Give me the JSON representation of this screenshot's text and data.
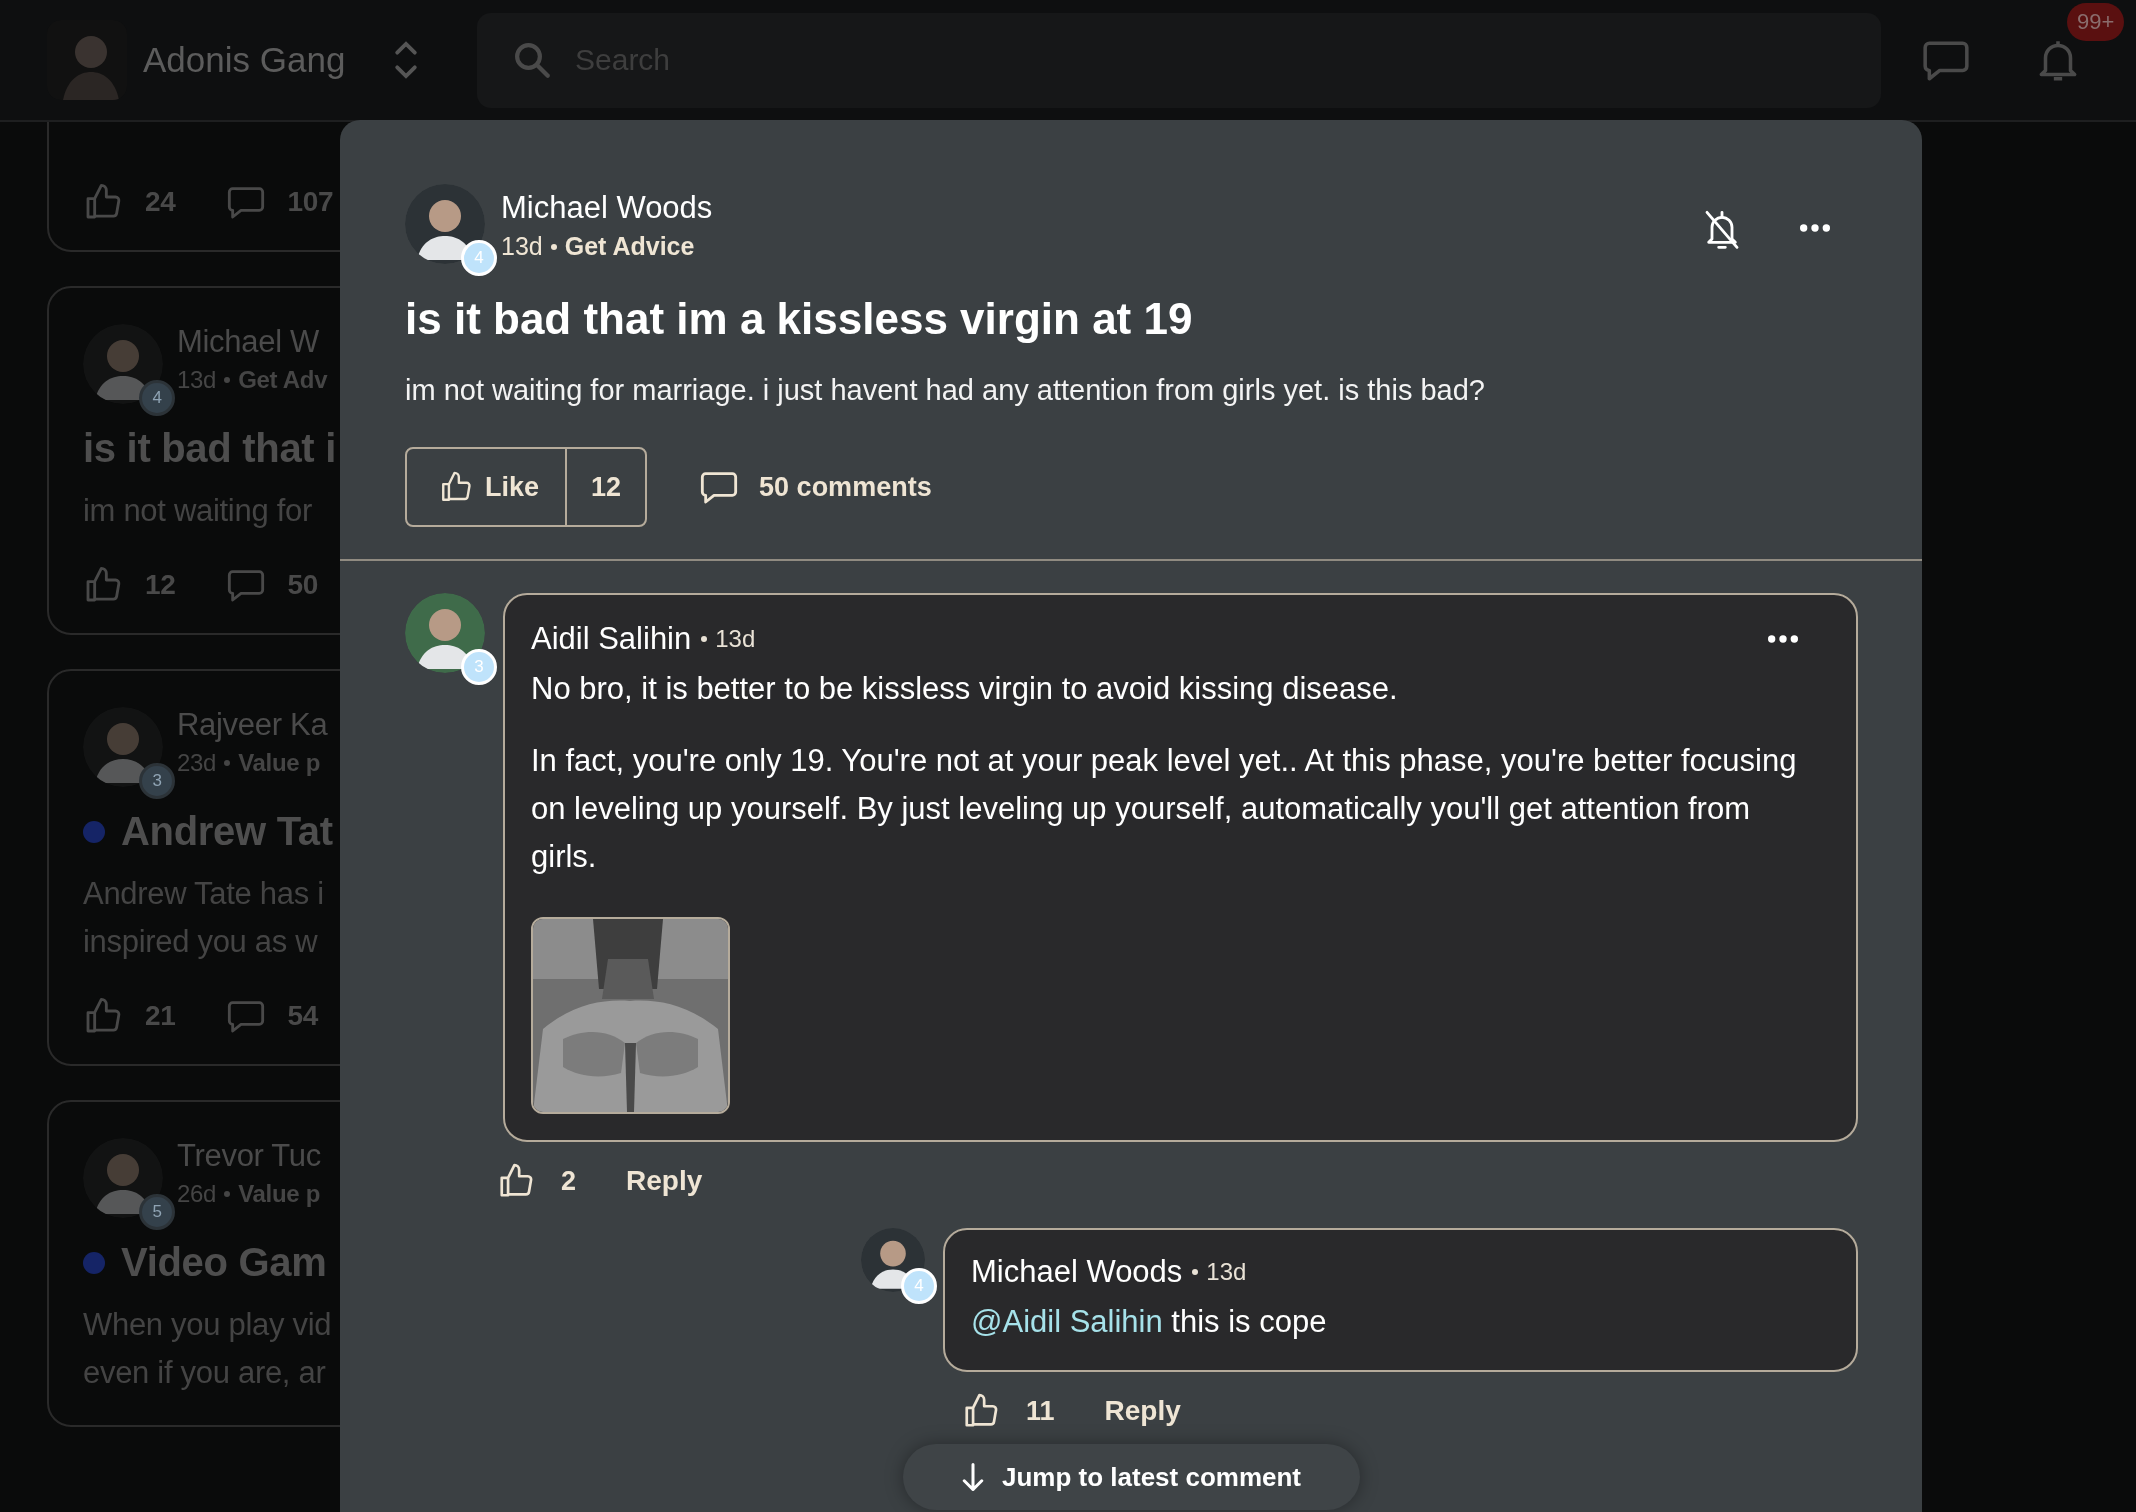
{
  "header": {
    "community": "Adonis Gang",
    "search": {
      "placeholder": "Search"
    },
    "notification_badge": "99+"
  },
  "feed": [
    {
      "likes": "24",
      "comments": "107"
    },
    {
      "author": "Michael W",
      "age": "13d",
      "category": "Get Adv",
      "level": "4",
      "title": "is it bad that i",
      "body": [
        "im not waiting for"
      ],
      "likes": "12",
      "comments": "50"
    },
    {
      "author": "Rajveer Ka",
      "age": "23d",
      "category": "Value p",
      "level": "3",
      "color": "#152466",
      "title": "Andrew Tat",
      "body": [
        "Andrew Tate has i",
        "inspired you as w"
      ],
      "likes": "21",
      "comments": "54"
    },
    {
      "author": "Trevor Tuc",
      "age": "26d",
      "category": "Value p",
      "level": "5",
      "color": "#152466",
      "title": "Video Gam",
      "body": [
        "When you play vid",
        "even if you are, ar"
      ]
    }
  ],
  "post": {
    "author": "Michael Woods",
    "level": "4",
    "age": "13d",
    "category": "Get Advice",
    "title": "is it bad that im a kissless virgin at 19",
    "body": "im not waiting for marriage. i just havent had any attention from girls yet. is this bad?",
    "like_label": "Like",
    "likes": "12",
    "comments": "50 comments"
  },
  "comments": [
    {
      "author": "Aidil Salihin",
      "age": "13d",
      "level": "3",
      "paragraphs": [
        "No bro, it is better to be kissless virgin to avoid kissing disease.",
        "In fact, you're only 19. You're not at your peak level yet.. At this phase, you're better focusing on leveling up yourself. By just leveling up yourself, automatically you'll get attention from girls."
      ],
      "attachment": {
        "kind": "picture"
      },
      "likes": "2",
      "reply_label": "Reply",
      "replies": [
        {
          "author": "Michael Woods",
          "age": "13d",
          "level": "4",
          "mention": "@Aidil Salihin",
          "text": " this is cope",
          "likes": "11",
          "reply_label": "Reply"
        }
      ]
    }
  ],
  "jump_button": "Jump to latest comment"
}
